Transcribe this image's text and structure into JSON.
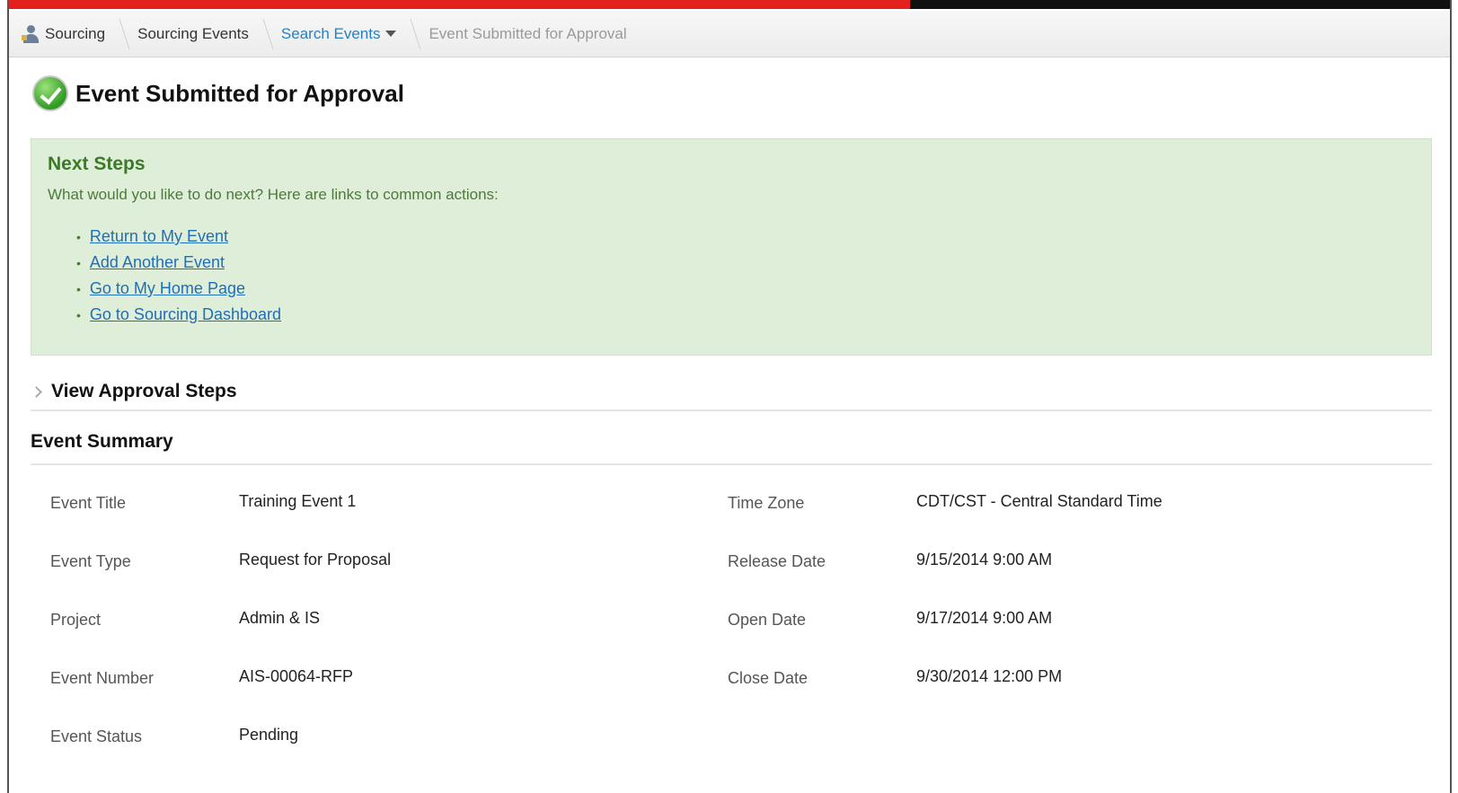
{
  "progress": {
    "fraction": 0.625,
    "fill_color": "#e2211c",
    "track_color": "#111111"
  },
  "breadcrumb": {
    "items": [
      {
        "label": "Sourcing",
        "icon": "sourcing-icon"
      },
      {
        "label": "Sourcing Events"
      },
      {
        "label": "Search Events",
        "icon": "chevron-down-icon"
      },
      {
        "label": "Event Submitted for Approval"
      }
    ]
  },
  "page": {
    "title": "Event Submitted for Approval",
    "title_icon": "check-icon"
  },
  "next_steps": {
    "heading": "Next Steps",
    "intro": "What would you like to do next? Here are links to common actions:",
    "links": [
      "Return to My Event",
      "Add Another Event",
      "Go to My Home Page",
      "Go to Sourcing Dashboard"
    ],
    "background_color": "#dfeed8"
  },
  "approval": {
    "label": "View Approval Steps"
  },
  "summary": {
    "heading": "Event Summary",
    "left": [
      {
        "label": "Event Title",
        "value": "Training Event 1"
      },
      {
        "label": "Event Type",
        "value": "Request for Proposal"
      },
      {
        "label": "Project",
        "value": "Admin & IS"
      },
      {
        "label": "Event Number",
        "value": "AIS-00064-RFP"
      },
      {
        "label": "Event Status",
        "value": "Pending"
      }
    ],
    "right": [
      {
        "label": "Time Zone",
        "value": "CDT/CST - Central Standard Time"
      },
      {
        "label": "Release Date",
        "value": "9/15/2014 9:00 AM"
      },
      {
        "label": "Open Date",
        "value": "9/17/2014 9:00 AM"
      },
      {
        "label": "Close Date",
        "value": "9/30/2014 12:00 PM"
      }
    ]
  }
}
